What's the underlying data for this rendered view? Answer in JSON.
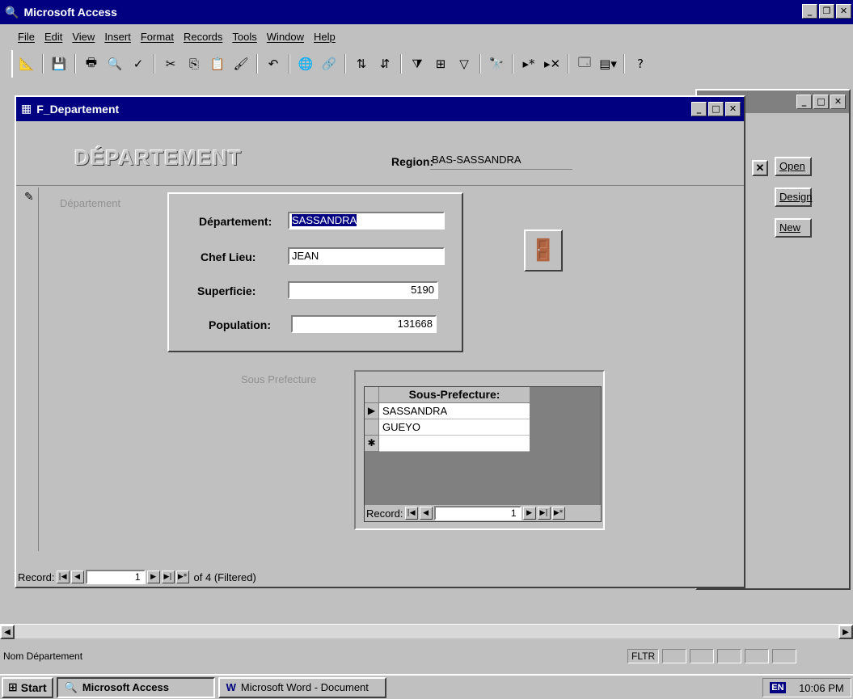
{
  "app": {
    "title": "Microsoft Access"
  },
  "menu": [
    "File",
    "Edit",
    "View",
    "Insert",
    "Format",
    "Records",
    "Tools",
    "Window",
    "Help"
  ],
  "toolbar_icons": [
    "view-icon",
    "save-icon",
    "print-icon",
    "print-preview-icon",
    "spelling-icon",
    "cut-icon",
    "copy-icon",
    "paste-icon",
    "format-painter-icon",
    "undo-icon",
    "insert-hyperlink-icon",
    "web-toolbar-icon",
    "sort-ascending-icon",
    "sort-descending-icon",
    "filter-by-selection-icon",
    "filter-by-form-icon",
    "apply-filter-icon",
    "find-icon",
    "new-record-icon",
    "delete-record-icon",
    "database-window-icon",
    "new-object-icon",
    "help-icon"
  ],
  "db_window": {
    "open": "Open",
    "design": "Design",
    "new": "New"
  },
  "form": {
    "title": "F_Departement",
    "heading": "DÉPARTEMENT",
    "region_label": "Region:",
    "region_value": "BAS-SASSANDRA",
    "group_caption": "Département",
    "departement_label": "Département:",
    "departement_value": "SASSANDRA",
    "chef_lieu_label": "Chef Lieu:",
    "chef_lieu_value": "JEAN",
    "superficie_label": "Superficie:",
    "superficie_value": "5190",
    "population_label": "Population:",
    "population_value": "131668",
    "sous_pref_caption": "Sous Prefecture",
    "nav": {
      "label": "Record:",
      "current": "1",
      "of_text": "of 4 (Filtered)"
    }
  },
  "subform": {
    "column_header": "Sous-Prefecture:",
    "rows": [
      "SASSANDRA",
      "GUEYO",
      ""
    ],
    "nav": {
      "label": "Record:",
      "current": "1"
    }
  },
  "statusbar": {
    "text": "Nom Département",
    "flag": "FLTR"
  },
  "taskbar": {
    "start": "Start",
    "items": [
      "Microsoft Access",
      "Microsoft Word - Document"
    ],
    "language": "EN",
    "clock": "10:06 PM"
  }
}
